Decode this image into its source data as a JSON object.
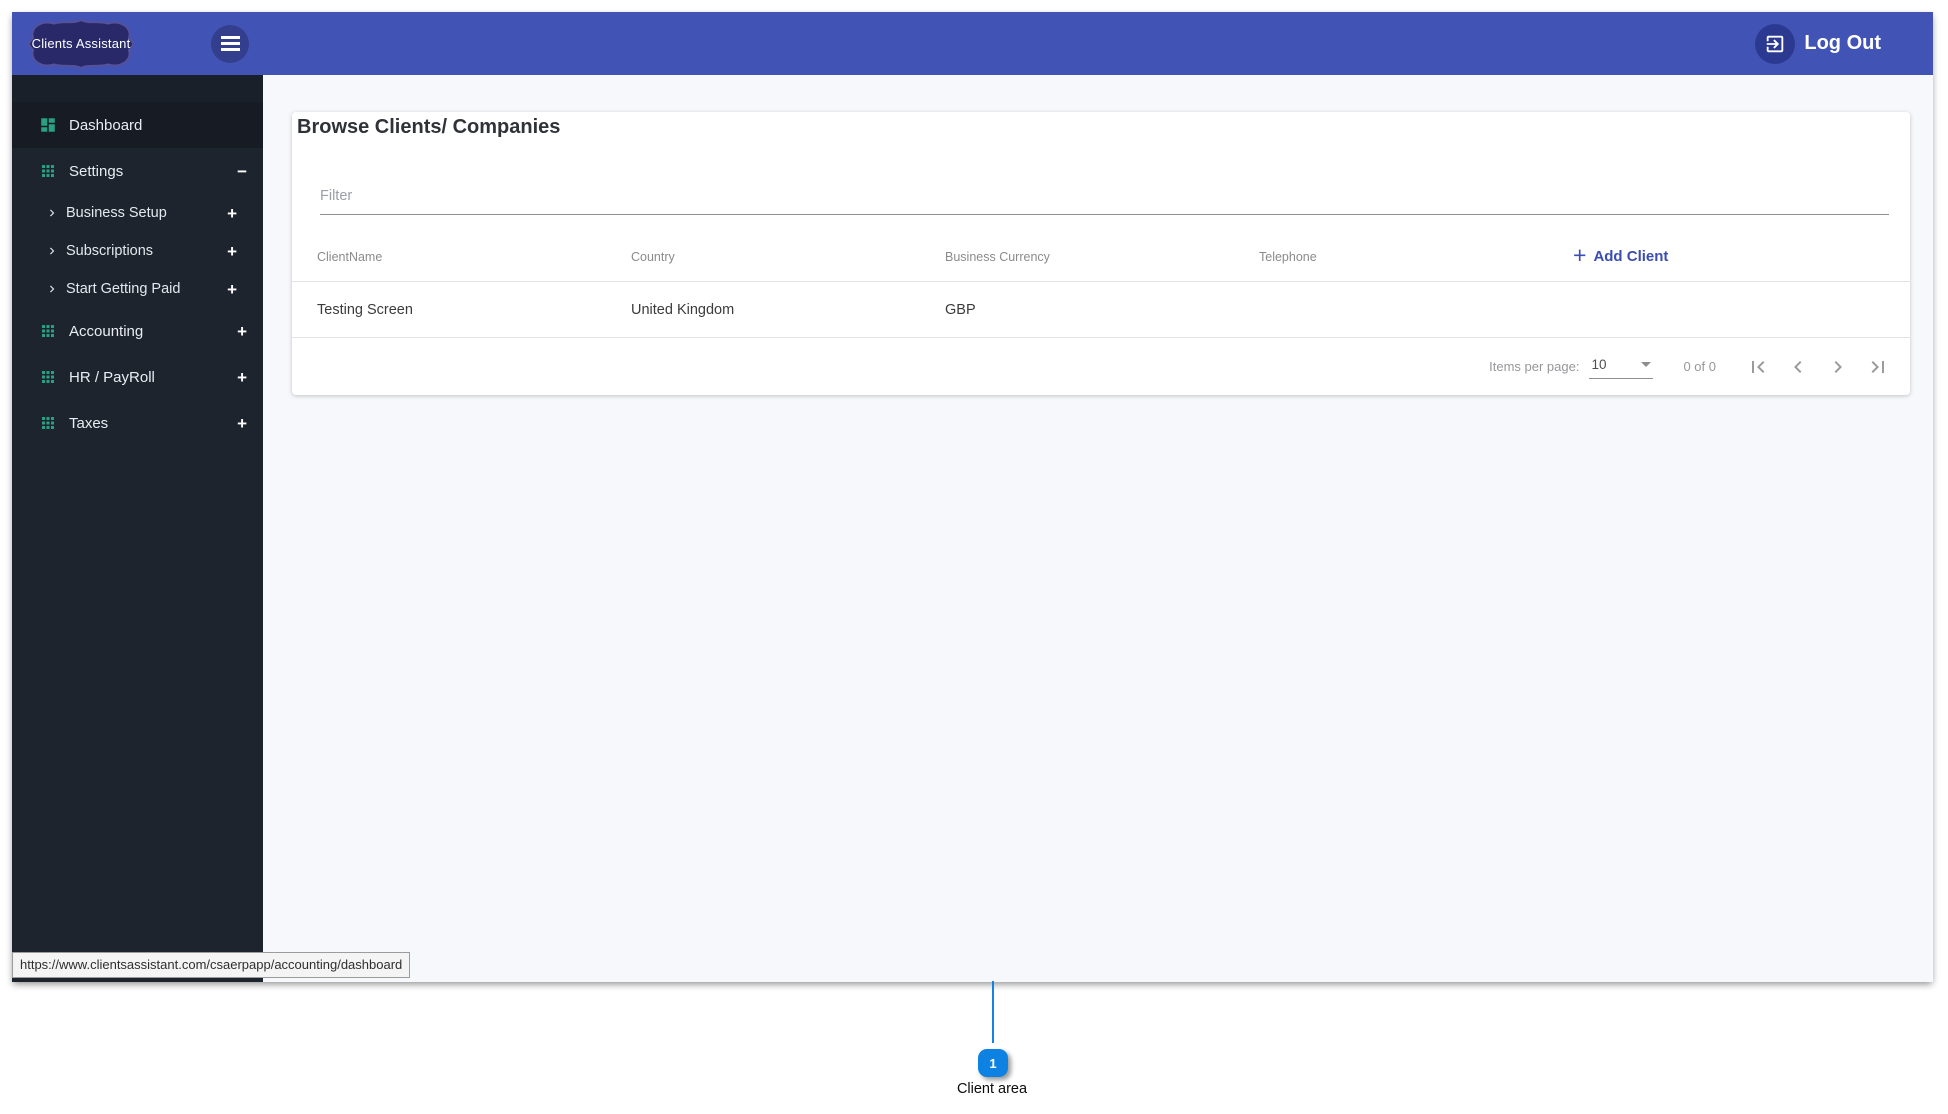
{
  "colors": {
    "navbar_blue": "#4153b5",
    "hamburger_circle": "#333f8d",
    "logout_circle": "#2c3990",
    "logo_bg": "#29296a",
    "logo_border": "#55519b",
    "sidebar_bg": "#1d242e",
    "sidebar_active_bg": "#161b24",
    "menu_icon_green": "#28a183",
    "accent_indigo": "#3b4db0",
    "callout_blue": "#0e82e2"
  },
  "glyphs": {
    "plus": "+",
    "minus": "−"
  },
  "navbar": {
    "logo_text": "Clients Assistant",
    "logout_label": "Log Out"
  },
  "sidebar": {
    "items": [
      {
        "label": "Dashboard",
        "level": "top",
        "icon": "dashboard-icon",
        "toggle": "",
        "active": true
      },
      {
        "label": "Settings",
        "level": "top",
        "icon": "grid-icon",
        "toggle": "−",
        "active": false
      },
      {
        "label": "Business Setup",
        "level": "sub",
        "icon": "chevron-right",
        "toggle": "+",
        "active": false
      },
      {
        "label": "Subscriptions",
        "level": "sub",
        "icon": "chevron-right",
        "toggle": "+",
        "active": false
      },
      {
        "label": "Start Getting Paid",
        "level": "sub",
        "icon": "chevron-right",
        "toggle": "+",
        "active": false
      },
      {
        "label": "Accounting",
        "level": "top",
        "icon": "grid-icon",
        "toggle": "+",
        "active": false
      },
      {
        "label": "HR / PayRoll",
        "level": "top",
        "icon": "grid-icon",
        "toggle": "+",
        "active": false
      },
      {
        "label": "Taxes",
        "level": "top",
        "icon": "grid-icon",
        "toggle": "+",
        "active": false
      }
    ]
  },
  "page": {
    "title": "Browse Clients/ Companies",
    "filter": {
      "placeholder": "Filter"
    },
    "table": {
      "columns": [
        "ClientName",
        "Country",
        "Business Currency",
        "Telephone"
      ],
      "add_client_label": "Add Client",
      "rows": [
        {
          "client_name": "Testing Screen",
          "country": "United Kingdom",
          "business_currency": "GBP",
          "telephone": ""
        }
      ]
    },
    "paginator": {
      "items_per_page_label": "Items per page:",
      "items_per_page_value": "10",
      "range_label": "0 of 0"
    }
  },
  "status_bar": {
    "url": "https://www.clientsassistant.com/csaerpapp/accounting/dashboard"
  },
  "annotation": {
    "number": "1",
    "label": "Client area"
  }
}
